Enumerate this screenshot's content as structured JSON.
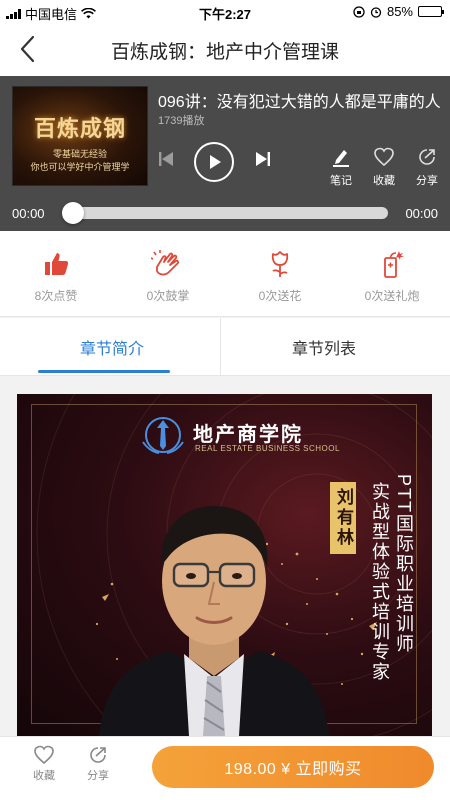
{
  "status_bar": {
    "carrier": "中国电信",
    "time": "下午2:27",
    "battery": "85%",
    "battery_level": 0.85
  },
  "navbar": {
    "back_icon": "chevron-left-icon",
    "title": "百炼成钢：地产中介管理课"
  },
  "player": {
    "cover": {
      "title": "百炼成钢",
      "line1": "零基础无经验",
      "line2": "你也可以学好中介管理学"
    },
    "track_title": "096讲：没有犯过大错的人都是平庸的人",
    "plays": "1739播放",
    "tools": [
      {
        "label": "笔记",
        "icon": "pen-note-icon"
      },
      {
        "label": "收藏",
        "icon": "heart-icon"
      },
      {
        "label": "分享",
        "icon": "share-icon"
      }
    ],
    "time_current": "00:00",
    "time_total": "00:00",
    "progress": 0
  },
  "actions": [
    {
      "label": "8次点赞",
      "icon": "thumbs-up-icon"
    },
    {
      "label": "0次鼓掌",
      "icon": "clap-icon"
    },
    {
      "label": "0次送花",
      "icon": "flower-icon"
    },
    {
      "label": "0次送礼炮",
      "icon": "firecracker-icon"
    }
  ],
  "tabs": [
    {
      "label": "章节简介",
      "active": true
    },
    {
      "label": "章节列表",
      "active": false
    }
  ],
  "poster": {
    "school_name": "地产商学院",
    "school_en": "REAL ESTATE BUSINESS SCHOOL",
    "name": "刘有林",
    "line1": "PTT国际职业培训师",
    "line2": "实战型体验式培训专家"
  },
  "bottom_bar": {
    "favorite_label": "收藏",
    "share_label": "分享",
    "buy_label": "198.00 ¥ 立即购买"
  },
  "colors": {
    "accent_blue": "#2b7fd4",
    "action_red": "#e0493a",
    "buy_orange": "#f29a33",
    "player_bg": "#4a4a4a"
  }
}
